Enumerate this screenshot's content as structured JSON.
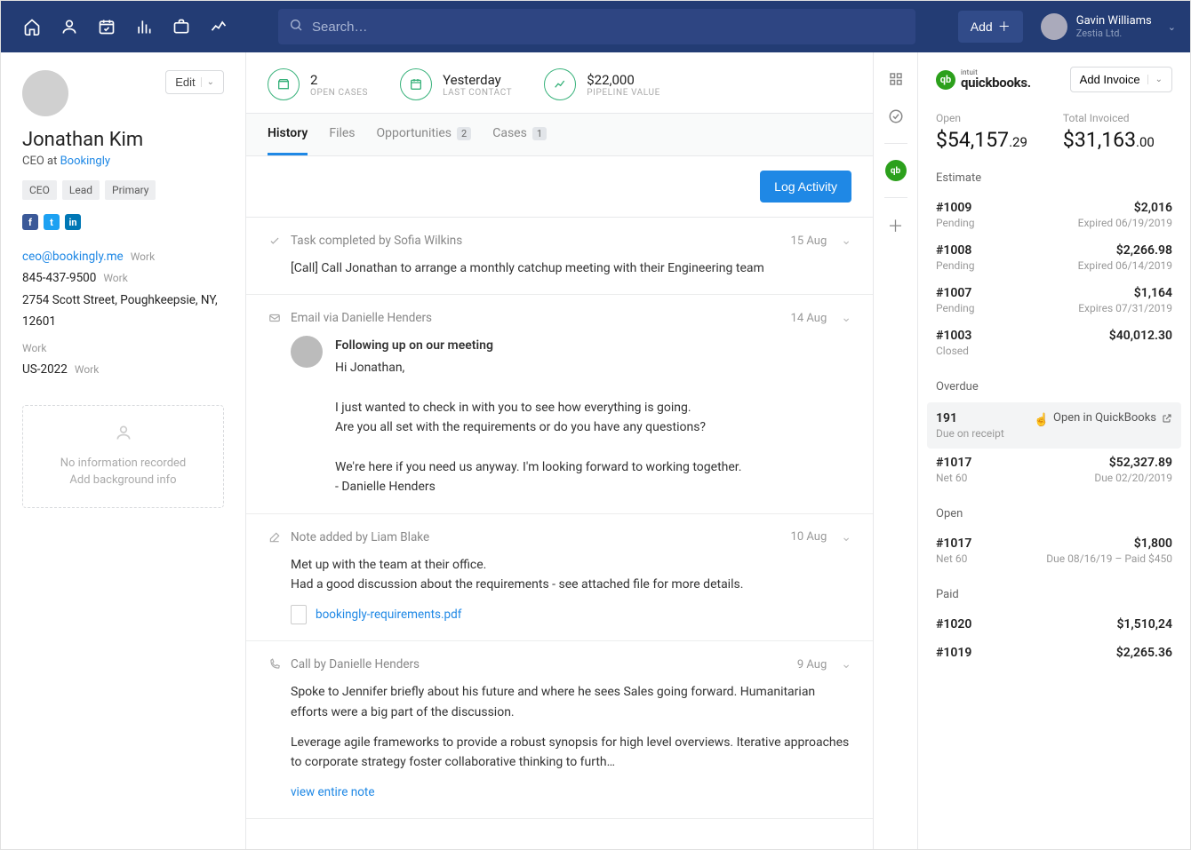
{
  "topnav": {
    "search_placeholder": "Search…",
    "add_label": "Add",
    "user_name": "Gavin Williams",
    "user_company": "Zestia Ltd."
  },
  "sidebar": {
    "edit_label": "Edit",
    "name": "Jonathan Kim",
    "role_prefix": "CEO at ",
    "company": "Bookingly",
    "tags": [
      "CEO",
      "Lead",
      "Primary"
    ],
    "email": "ceo@bookingly.me",
    "phone": "845-437-9500",
    "address": "2754 Scott Street, Poughkeepsie, NY, 12601",
    "region": "US-2022",
    "label_work": "Work",
    "info_l1": "No information recorded",
    "info_l2": "Add background info"
  },
  "metrics": {
    "m1_value": "2",
    "m1_label": "OPEN CASES",
    "m2_value": "Yesterday",
    "m2_label": "LAST CONTACT",
    "m3_value": "$22,000",
    "m3_label": "PIPELINE VALUE"
  },
  "tabs": {
    "history": "History",
    "files": "Files",
    "opportunities": "Opportunities",
    "opp_badge": "2",
    "cases": "Cases",
    "cases_badge": "1"
  },
  "log_button": "Log Activity",
  "feed": {
    "item1": {
      "title": "Task completed by Sofia Wilkins",
      "date": "15 Aug",
      "body": "[Call] Call Jonathan to arrange a monthly catchup meeting with their Engineering team"
    },
    "item2": {
      "title": "Email via Danielle Henders",
      "date": "14 Aug",
      "subject": "Following up on our meeting",
      "greeting": "Hi Jonathan,",
      "p1": "I just wanted to check in with you to see how everything is going.",
      "p2": "Are you all set with the requirements or do you have any questions?",
      "p3": "We're here if you need us anyway. I'm looking forward to working together.",
      "signoff": "- Danielle Henders"
    },
    "item3": {
      "title": "Note added by Liam Blake",
      "date": "10 Aug",
      "l1": "Met up with the team at their office.",
      "l2": "Had a good discussion about the requirements - see attached file for more details.",
      "file": "bookingly-requirements.pdf"
    },
    "item4": {
      "title": "Call by Danielle Henders",
      "date": "9 Aug",
      "p1": "Spoke to Jennifer briefly about his future and where he sees Sales going forward. Humanitarian efforts were a big part of the discussion.",
      "p2": "Leverage agile frameworks to provide a robust synopsis for high level overviews. Iterative approaches to corporate strategy foster collaborative thinking to furth…",
      "view": "view entire note"
    }
  },
  "qb": {
    "intuit": "intuit",
    "brand": "quickbooks.",
    "add_invoice": "Add Invoice",
    "open_label": "Open",
    "total_label": "Total Invoiced",
    "open_amount_main": "$54,157",
    "open_amount_cents": ".29",
    "total_amount_main": "$31,163",
    "total_amount_cents": ".00",
    "section_estimate": "Estimate",
    "section_overdue": "Overdue",
    "section_open": "Open",
    "section_paid": "Paid",
    "open_in_qb": "Open in QuickBooks",
    "estimates": {
      "e1": {
        "id": "#1009",
        "status": "Pending",
        "amt": "$2,016",
        "date": "Expired 06/19/2019"
      },
      "e2": {
        "id": "#1008",
        "status": "Pending",
        "amt": "$2,266.98",
        "date": "Expired 06/14/2019"
      },
      "e3": {
        "id": "#1007",
        "status": "Pending",
        "amt": "$1,164",
        "date": "Expires 07/31/2019"
      },
      "e4": {
        "id": "#1003",
        "status": "Closed",
        "amt": "$40,012.30",
        "date": ""
      }
    },
    "overdue": {
      "o1": {
        "id": "191",
        "status": "Due on receipt"
      },
      "o2": {
        "id": "#1017",
        "status": "Net 60",
        "amt": "$52,327.89",
        "date": "Due 02/20/2019"
      }
    },
    "open": {
      "p1": {
        "id": "#1017",
        "status": "Net 60",
        "amt": "$1,800",
        "date": "Due 08/16/19 – Paid $450"
      }
    },
    "paid": {
      "d1": {
        "id": "#1020",
        "amt": "$1,510,24"
      },
      "d2": {
        "id": "#1019",
        "amt": "$2,265.36"
      }
    }
  }
}
